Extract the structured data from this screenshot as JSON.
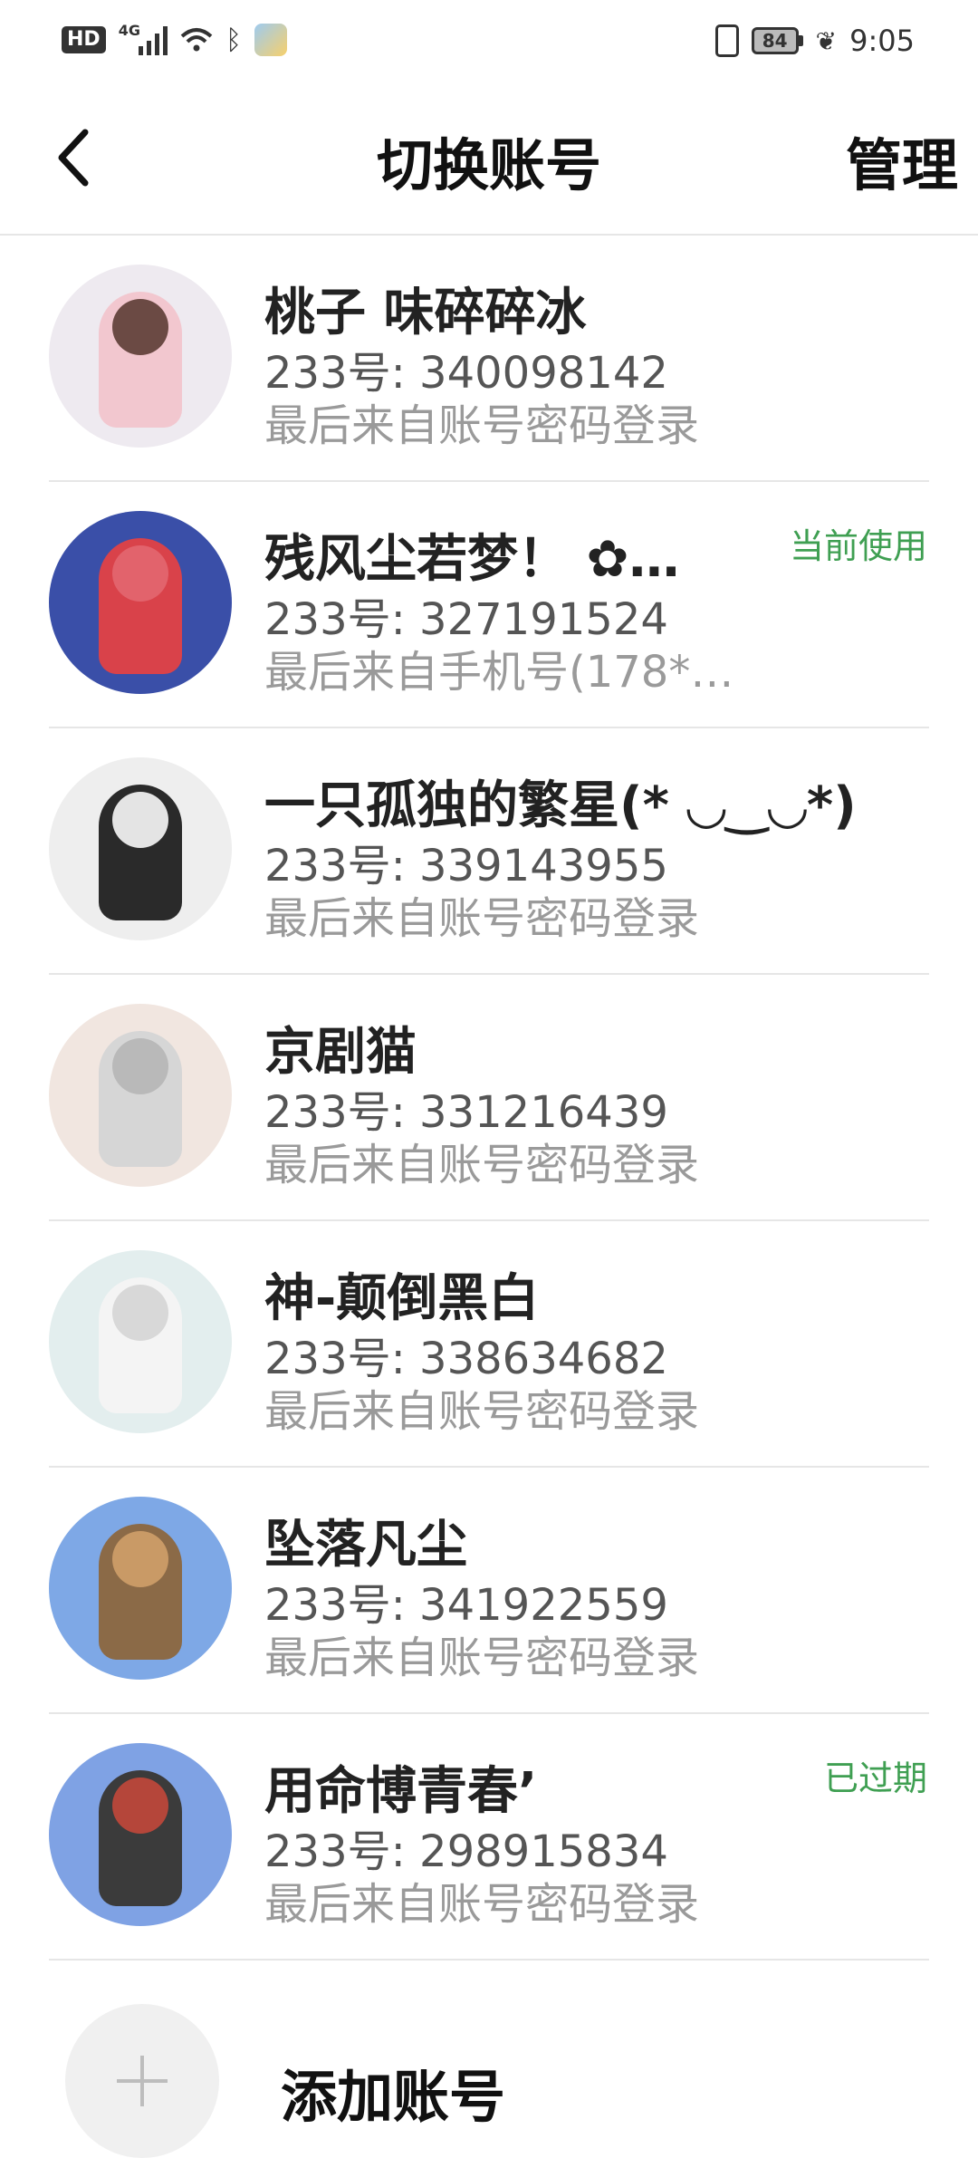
{
  "status_bar": {
    "hd": "HD",
    "network": "4G",
    "battery": "84",
    "time": "9:05"
  },
  "navbar": {
    "title": "切换账号",
    "manage_label": "管理"
  },
  "accounts": [
    {
      "name": "桃子 味碎碎冰",
      "uid": "233号: 340098142",
      "source": "最后来自账号密码登录",
      "badge": "",
      "avatar_bg": "#eeeaf0",
      "avatar_fig": "#f2c7cf",
      "avatar_head": "#6b4a44"
    },
    {
      "name": "残风尘若梦！ ✿…",
      "uid": "233号: 327191524",
      "source": "最后来自手机号(178*…",
      "badge": "当前使用",
      "avatar_bg": "#3a4fa8",
      "avatar_fig": "#d9424a",
      "avatar_head": "#e2636c"
    },
    {
      "name": "一只孤独的繁星(* ◡‿◡*)",
      "uid": "233号: 339143955",
      "source": "最后来自账号密码登录",
      "badge": "",
      "avatar_bg": "#eeeeee",
      "avatar_fig": "#2a2a2a",
      "avatar_head": "#e4e4e4"
    },
    {
      "name": "京剧猫",
      "uid": "233号: 331216439",
      "source": "最后来自账号密码登录",
      "badge": "",
      "avatar_bg": "#f1e6e0",
      "avatar_fig": "#d6d6d6",
      "avatar_head": "#b9b9b9"
    },
    {
      "name": "神-颠倒黑白",
      "uid": "233号: 338634682",
      "source": "最后来自账号密码登录",
      "badge": "",
      "avatar_bg": "#e3eeee",
      "avatar_fig": "#f4f4f4",
      "avatar_head": "#d8d8d8"
    },
    {
      "name": "坠落凡尘",
      "uid": "233号: 341922559",
      "source": "最后来自账号密码登录",
      "badge": "",
      "avatar_bg": "#7ea8e6",
      "avatar_fig": "#8b6a47",
      "avatar_head": "#c99a66"
    },
    {
      "name": "用命博青春’",
      "uid": "233号: 298915834",
      "source": "最后来自账号密码登录",
      "badge": "已过期",
      "avatar_bg": "#7fa2e4",
      "avatar_fig": "#3b3b3b",
      "avatar_head": "#b5463a"
    }
  ],
  "add_account": {
    "label": "添加账号"
  }
}
